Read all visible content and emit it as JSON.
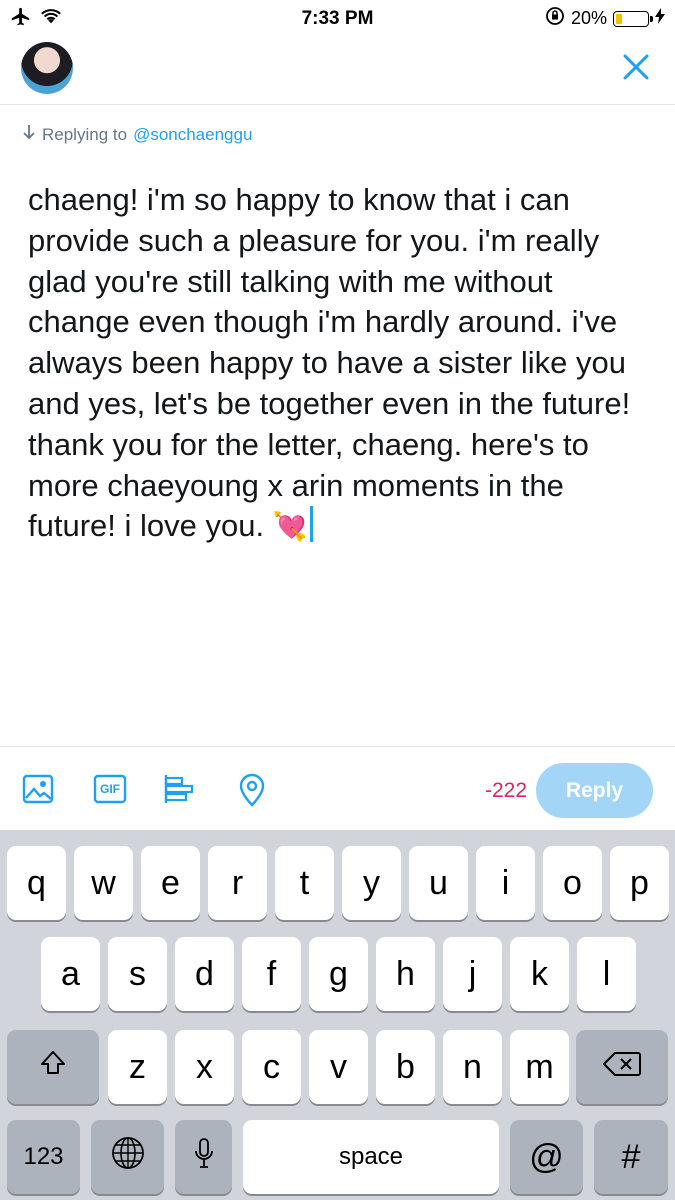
{
  "status_bar": {
    "time": "7:33 PM",
    "battery_percent": "20%",
    "battery_level": 0.2
  },
  "header": {
    "avatar": "avatar",
    "close_icon": "close-icon"
  },
  "replying": {
    "prefix": "Replying to",
    "handle": "@sonchaenggu"
  },
  "compose": {
    "text": "chaeng! i'm so happy to know that i can provide such a pleasure for you. i'm really glad you're still talking with me without change even though i'm hardly around. i've always been happy to have a sister like you and yes, let's be together even in the future! thank you for the letter, chaeng. here's to more chaeyoung x arin moments in the future! i love you. ",
    "emoji": "💘"
  },
  "toolbar": {
    "icons": [
      "image-icon",
      "gif-icon",
      "poll-icon",
      "location-icon"
    ],
    "gif_label": "GIF",
    "counter": "-222",
    "reply_label": "Reply"
  },
  "keyboard": {
    "row1": [
      "q",
      "w",
      "e",
      "r",
      "t",
      "y",
      "u",
      "i",
      "o",
      "p"
    ],
    "row2": [
      "a",
      "s",
      "d",
      "f",
      "g",
      "h",
      "j",
      "k",
      "l"
    ],
    "row3": [
      "z",
      "x",
      "c",
      "v",
      "b",
      "n",
      "m"
    ],
    "numbers_label": "123",
    "space_label": "space",
    "at_label": "@",
    "hash_label": "#"
  }
}
